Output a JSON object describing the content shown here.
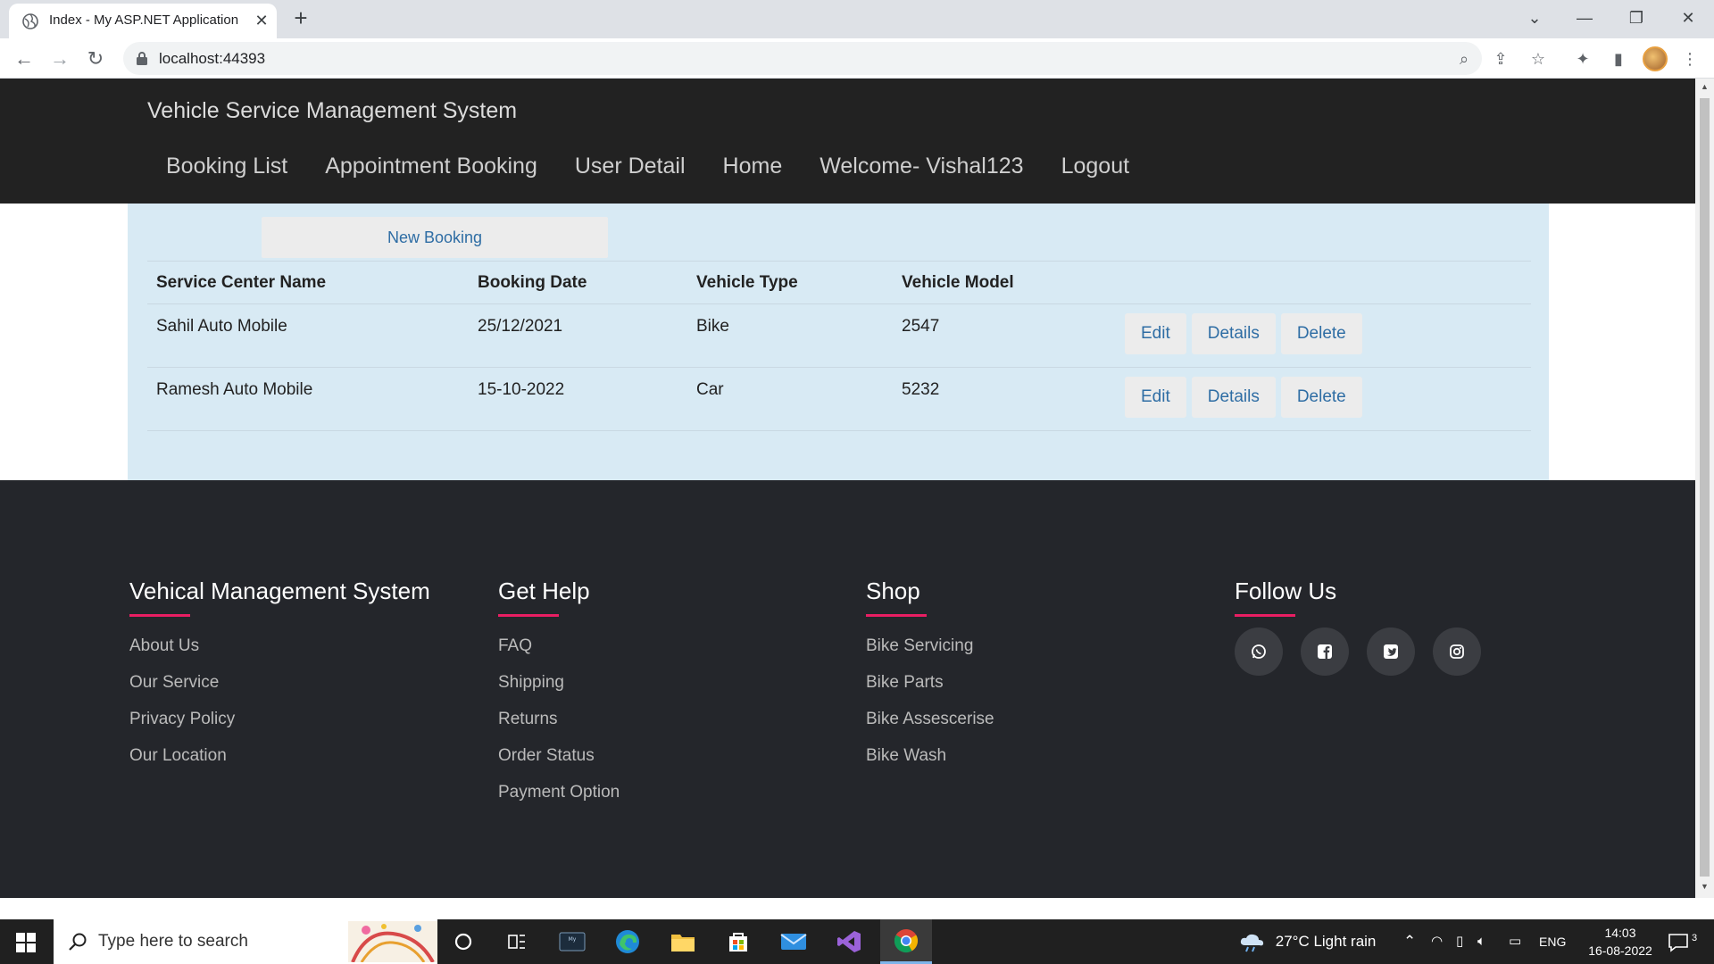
{
  "browser": {
    "tab_title": "Index - My ASP.NET Application",
    "url": "localhost:44393"
  },
  "site": {
    "brand": "Vehicle Service Management System",
    "menu": [
      {
        "label": "Booking List"
      },
      {
        "label": "Appointment Booking"
      },
      {
        "label": "User Detail"
      },
      {
        "label": "Home"
      },
      {
        "label": "Welcome- Vishal123"
      },
      {
        "label": "Logout"
      }
    ]
  },
  "bookings": {
    "new_booking_label": "New Booking",
    "columns": [
      "Service Center Name",
      "Booking Date",
      "Vehicle Type",
      "Vehicle Model"
    ],
    "rows": [
      {
        "center": "Sahil Auto Mobile",
        "date": "25/12/2021",
        "type": "Bike",
        "model": "2547"
      },
      {
        "center": "Ramesh Auto Mobile",
        "date": "15-10-2022",
        "type": "Car",
        "model": "5232"
      }
    ],
    "actions": {
      "edit": "Edit",
      "details": "Details",
      "delete": "Delete"
    }
  },
  "footer": {
    "col1": {
      "title": "Vehical Management System",
      "links": [
        "About Us",
        "Our Service",
        "Privacy Policy",
        "Our Location"
      ]
    },
    "col2": {
      "title": "Get Help",
      "links": [
        "FAQ",
        "Shipping",
        "Returns",
        "Order Status",
        "Payment Option"
      ]
    },
    "col3": {
      "title": "Shop",
      "links": [
        "Bike Servicing",
        "Bike Parts",
        "Bike Assescerise",
        "Bike Wash"
      ]
    },
    "col4": {
      "title": "Follow Us",
      "social": [
        "whatsapp-icon",
        "facebook-icon",
        "twitter-icon",
        "instagram-icon"
      ]
    },
    "accent_color": "#e91e63"
  },
  "taskbar": {
    "search_placeholder": "Type here to search",
    "weather": "27°C  Light rain",
    "language": "ENG",
    "time": "14:03",
    "date": "16-08-2022",
    "notifications": "3"
  }
}
